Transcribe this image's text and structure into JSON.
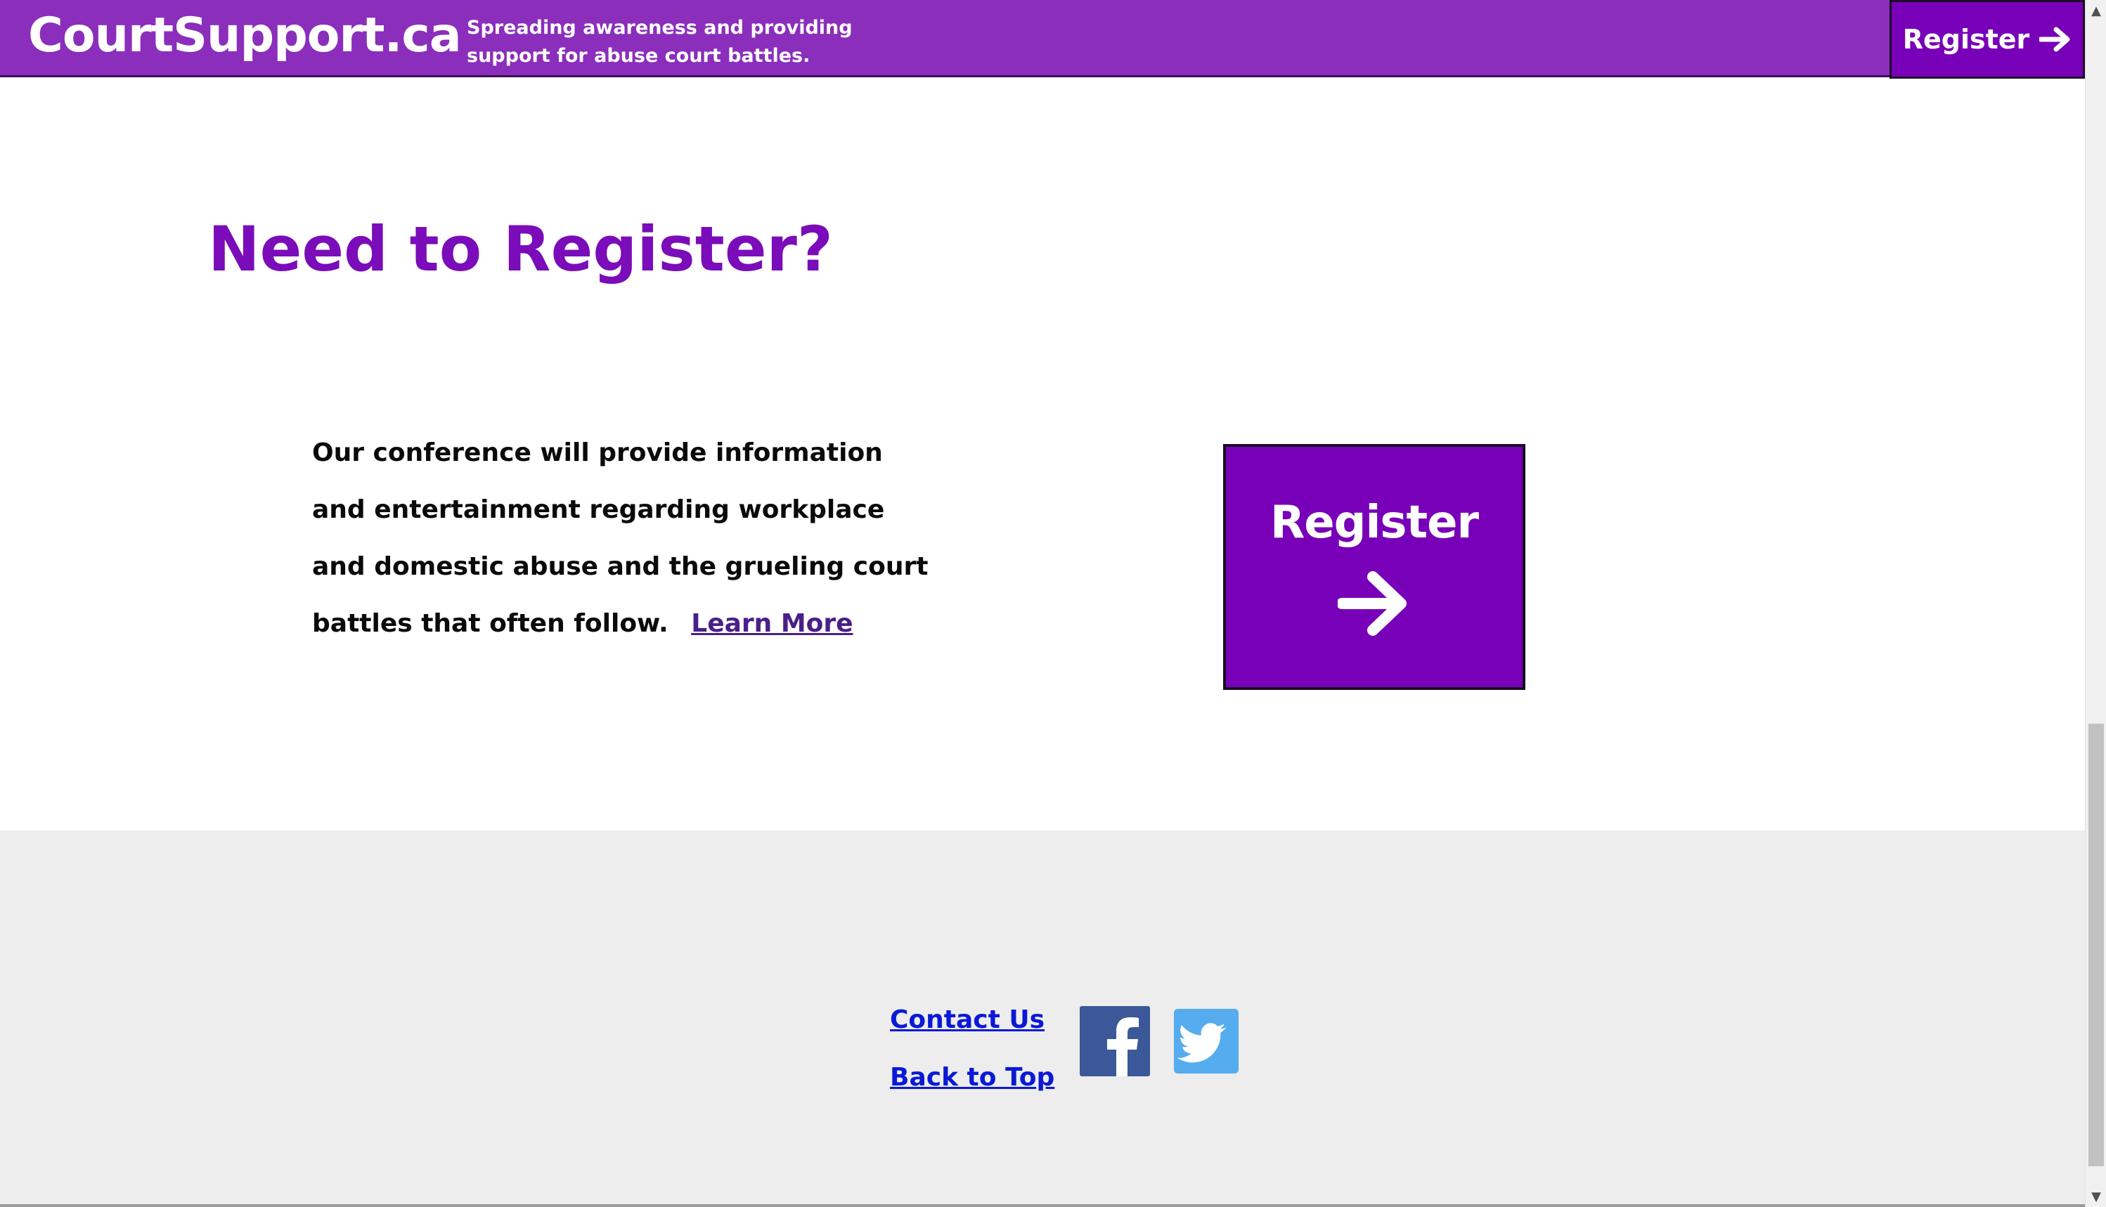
{
  "header": {
    "brand": "CourtSupport.ca",
    "tagline": "Spreading awareness and providing support for abuse court battles.",
    "register_label": "Register"
  },
  "main": {
    "title": "Need to Register?",
    "body": "Our conference will provide information and entertainment regarding workplace and domestic abuse and the grueling court battles that often follow.",
    "learn_more": "Learn More",
    "register_button_label": "Register"
  },
  "footer": {
    "links": [
      "Contact Us",
      "Back to Top"
    ],
    "social": [
      "facebook-icon",
      "twitter-icon"
    ]
  },
  "colors": {
    "header_bg": "#8b2ebc",
    "accent": "#7800b8",
    "title": "#7b0cba",
    "footer_bg": "#ededed",
    "link": "#0a19d6",
    "facebook": "#3b5998",
    "twitter": "#55acee"
  }
}
